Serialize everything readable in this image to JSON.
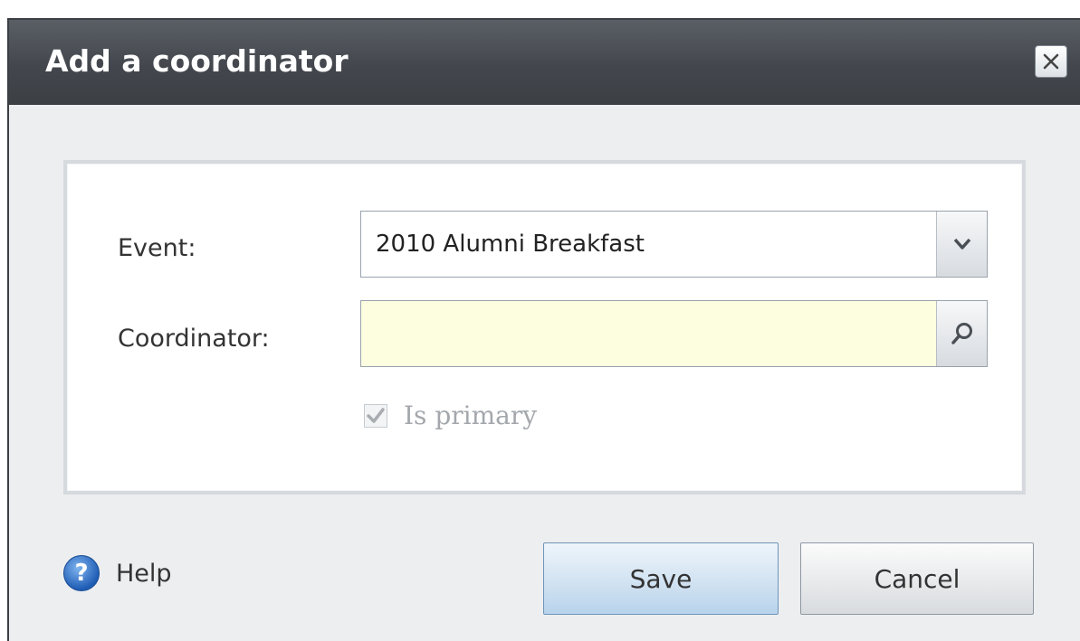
{
  "dialog": {
    "title": "Add a coordinator",
    "close_icon": "close-icon"
  },
  "form": {
    "event_label": "Event:",
    "event_value": "2010 Alumni Breakfast",
    "event_dropdown_icon": "chevron-down-icon",
    "coordinator_label": "Coordinator:",
    "coordinator_value": "",
    "coordinator_search_icon": "search-icon",
    "coordinator_field_color": "#fdfde0",
    "is_primary_label": "Is primary",
    "is_primary_checked": true,
    "is_primary_disabled": true
  },
  "footer": {
    "help_label": "Help",
    "help_icon": "help-icon",
    "save_label": "Save",
    "cancel_label": "Cancel"
  }
}
